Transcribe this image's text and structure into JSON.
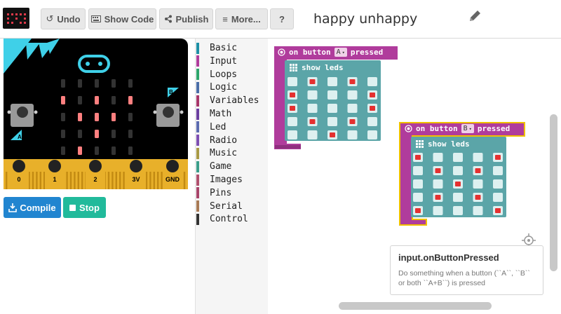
{
  "toolbar": {
    "undo_label": "Undo",
    "show_code_label": "Show Code",
    "publish_label": "Publish",
    "more_label": "More...",
    "help_label": "?",
    "project_title": "happy unhappy"
  },
  "simulator": {
    "pins": [
      "0",
      "1",
      "2",
      "3V",
      "GND"
    ],
    "button_a": "A",
    "button_b": "B",
    "compile_label": "Compile",
    "stop_label": "Stop",
    "led_on_color": "#e0394a",
    "leds": [
      [
        0,
        0,
        0,
        0,
        0
      ],
      [
        1,
        0,
        1,
        0,
        1
      ],
      [
        0,
        1,
        1,
        1,
        0
      ],
      [
        0,
        0,
        1,
        0,
        0
      ],
      [
        0,
        1,
        0,
        0,
        0
      ]
    ]
  },
  "toolbox": {
    "categories": [
      {
        "label": "Basic",
        "color": "#1e90a6"
      },
      {
        "label": "Input",
        "color": "#b03c9c"
      },
      {
        "label": "Loops",
        "color": "#2ea56b"
      },
      {
        "label": "Logic",
        "color": "#4b6ea8"
      },
      {
        "label": "Variables",
        "color": "#a8366a"
      },
      {
        "label": "Math",
        "color": "#6b3fa0"
      },
      {
        "label": "Led",
        "color": "#5c6bb0"
      },
      {
        "label": "Radio",
        "color": "#7e4fb3"
      },
      {
        "label": "Music",
        "color": "#a89a45"
      },
      {
        "label": "Game",
        "color": "#3b9e8a"
      },
      {
        "label": "Images",
        "color": "#b0506e"
      },
      {
        "label": "Pins",
        "color": "#a8456a"
      },
      {
        "label": "Serial",
        "color": "#a87a55"
      },
      {
        "label": "Control",
        "color": "#333333"
      }
    ]
  },
  "blocks": [
    {
      "event_prefix": "on button",
      "button": "A",
      "event_suffix": "pressed",
      "inner_label": "show leds",
      "leds": [
        [
          0,
          1,
          0,
          1,
          0
        ],
        [
          1,
          0,
          0,
          0,
          1
        ],
        [
          1,
          0,
          0,
          0,
          1
        ],
        [
          0,
          1,
          0,
          1,
          0
        ],
        [
          0,
          0,
          1,
          0,
          0
        ]
      ]
    },
    {
      "event_prefix": "on button",
      "button": "B",
      "event_suffix": "pressed",
      "inner_label": "show leds",
      "leds": [
        [
          1,
          0,
          0,
          0,
          1
        ],
        [
          0,
          1,
          0,
          1,
          0
        ],
        [
          0,
          0,
          1,
          0,
          0
        ],
        [
          0,
          1,
          0,
          1,
          0
        ],
        [
          1,
          0,
          0,
          0,
          1
        ]
      ]
    }
  ],
  "help_tooltip": {
    "title": "input.onButtonPressed",
    "description": "Do something when a button (``A``, ``B`` or both ``A+B``) is pressed"
  },
  "colors": {
    "event_block": "#b03c9c",
    "led_block": "#5ba5a8",
    "selected_outline": "#f0c000",
    "led_red": "#e53030",
    "led_off": "#ddf0f0"
  }
}
